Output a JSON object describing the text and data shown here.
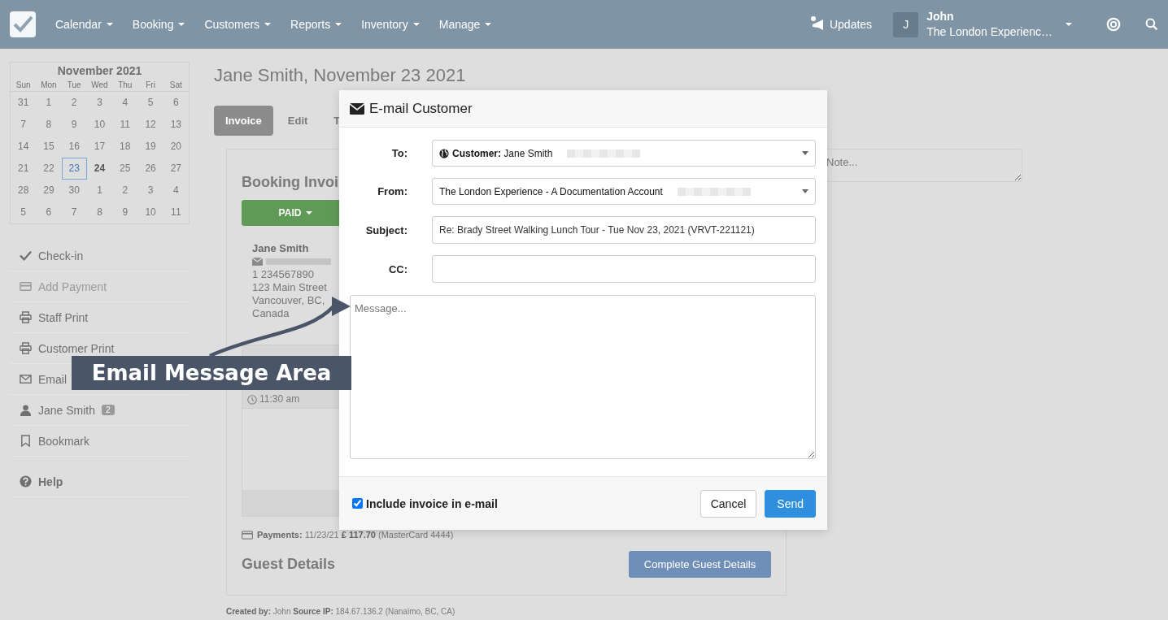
{
  "nav": {
    "menus": [
      {
        "label": "Calendar"
      },
      {
        "label": "Booking"
      },
      {
        "label": "Customers"
      },
      {
        "label": "Reports"
      },
      {
        "label": "Inventory"
      },
      {
        "label": "Manage"
      }
    ],
    "updates": "Updates",
    "user": {
      "initial": "J",
      "name": "John",
      "company": "The London Experienc…"
    }
  },
  "calendar": {
    "month": "November 2021",
    "weekdays": [
      "Sun",
      "Mon",
      "Tue",
      "Wed",
      "Thu",
      "Fri",
      "Sat"
    ],
    "weeks": [
      [
        {
          "day": "31",
          "selected": false,
          "today": false
        },
        {
          "day": "1",
          "selected": false,
          "today": false
        },
        {
          "day": "2",
          "selected": false,
          "today": false
        },
        {
          "day": "3",
          "selected": false,
          "today": false
        },
        {
          "day": "4",
          "selected": false,
          "today": false
        },
        {
          "day": "5",
          "selected": false,
          "today": false
        },
        {
          "day": "6",
          "selected": false,
          "today": false
        }
      ],
      [
        {
          "day": "7",
          "selected": false,
          "today": false
        },
        {
          "day": "8",
          "selected": false,
          "today": false
        },
        {
          "day": "9",
          "selected": false,
          "today": false
        },
        {
          "day": "10",
          "selected": false,
          "today": false
        },
        {
          "day": "11",
          "selected": false,
          "today": false
        },
        {
          "day": "12",
          "selected": false,
          "today": false
        },
        {
          "day": "13",
          "selected": false,
          "today": false
        }
      ],
      [
        {
          "day": "14",
          "selected": false,
          "today": false
        },
        {
          "day": "15",
          "selected": false,
          "today": false
        },
        {
          "day": "16",
          "selected": false,
          "today": false
        },
        {
          "day": "17",
          "selected": false,
          "today": false
        },
        {
          "day": "18",
          "selected": false,
          "today": false
        },
        {
          "day": "19",
          "selected": false,
          "today": false
        },
        {
          "day": "20",
          "selected": false,
          "today": false
        }
      ],
      [
        {
          "day": "21",
          "selected": false,
          "today": false
        },
        {
          "day": "22",
          "selected": false,
          "today": false
        },
        {
          "day": "23",
          "selected": true,
          "today": false
        },
        {
          "day": "24",
          "selected": false,
          "today": true
        },
        {
          "day": "25",
          "selected": false,
          "today": false
        },
        {
          "day": "26",
          "selected": false,
          "today": false
        },
        {
          "day": "27",
          "selected": false,
          "today": false
        }
      ],
      [
        {
          "day": "28",
          "selected": false,
          "today": false
        },
        {
          "day": "29",
          "selected": false,
          "today": false
        },
        {
          "day": "30",
          "selected": false,
          "today": false
        },
        {
          "day": "1",
          "selected": false,
          "today": false
        },
        {
          "day": "2",
          "selected": false,
          "today": false
        },
        {
          "day": "3",
          "selected": false,
          "today": false
        },
        {
          "day": "4",
          "selected": false,
          "today": false
        }
      ],
      [
        {
          "day": "5",
          "selected": false,
          "today": false
        },
        {
          "day": "6",
          "selected": false,
          "today": false
        },
        {
          "day": "7",
          "selected": false,
          "today": false
        },
        {
          "day": "8",
          "selected": false,
          "today": false
        },
        {
          "day": "9",
          "selected": false,
          "today": false
        },
        {
          "day": "10",
          "selected": false,
          "today": false
        },
        {
          "day": "11",
          "selected": false,
          "today": false
        }
      ]
    ]
  },
  "sidebar": {
    "items": [
      {
        "label": "Check-in",
        "kind": "check",
        "disabled": false
      },
      {
        "label": "Add Payment",
        "kind": "card",
        "disabled": true
      },
      {
        "label": "Staff Print",
        "kind": "print",
        "disabled": false
      },
      {
        "label": "Customer Print",
        "kind": "print",
        "disabled": false
      },
      {
        "label": "Email",
        "kind": "mail",
        "disabled": false
      },
      {
        "label": "Jane Smith",
        "kind": "user",
        "disabled": false,
        "badge": "2"
      },
      {
        "label": "Bookmark",
        "kind": "bookmark",
        "disabled": false
      }
    ],
    "help": "Help"
  },
  "page": {
    "title": "Jane Smith, November 23 2021",
    "tabs": [
      {
        "label": "Invoice",
        "selected": true
      },
      {
        "label": "Edit",
        "selected": false
      },
      {
        "label": "T",
        "selected": false
      }
    ],
    "invoice": {
      "heading": "Booking Invoi",
      "status": "PAID",
      "customer": {
        "name": "Jane Smith",
        "phone": "1 234567890",
        "address": [
          "123 Main Street",
          "Vancouver, BC,",
          "Canada"
        ]
      },
      "time": "11:30 am",
      "payments": "**Payments:** 11/23/21 **£ 117.70** (MasterCard 4444)",
      "guest_heading": "Guest Details",
      "guest_button": "Complete Guest Details"
    },
    "footer": "**Created by:** John **Source IP:** 184.67.136.2 (Nanaimo, BC, CA)",
    "note": {
      "placeholder": "Note..."
    }
  },
  "dialog": {
    "title": "E-mail Customer",
    "fields": [
      {
        "label": "To:",
        "kind": "select",
        "value": "**Customer:** Jane Smith",
        "globe": true
      },
      {
        "label": "From:",
        "kind": "select",
        "value": "The London Experience - A Documentation Account",
        "globe": false
      },
      {
        "label": "Subject:",
        "kind": "input",
        "value": "Re: Brady Street Walking Lunch Tour - Tue Nov 23, 2021 (VRVT-221121)"
      },
      {
        "label": "CC:",
        "kind": "input"
      }
    ],
    "message": {
      "placeholder": "Message..."
    },
    "include_invoice": {
      "label": "Include invoice in e-mail",
      "checked": true
    },
    "buttons": [
      {
        "label": "Cancel",
        "kind": "default"
      },
      {
        "label": "Send",
        "kind": "primary"
      }
    ]
  },
  "annotation": {
    "text": "Email Message Area"
  }
}
